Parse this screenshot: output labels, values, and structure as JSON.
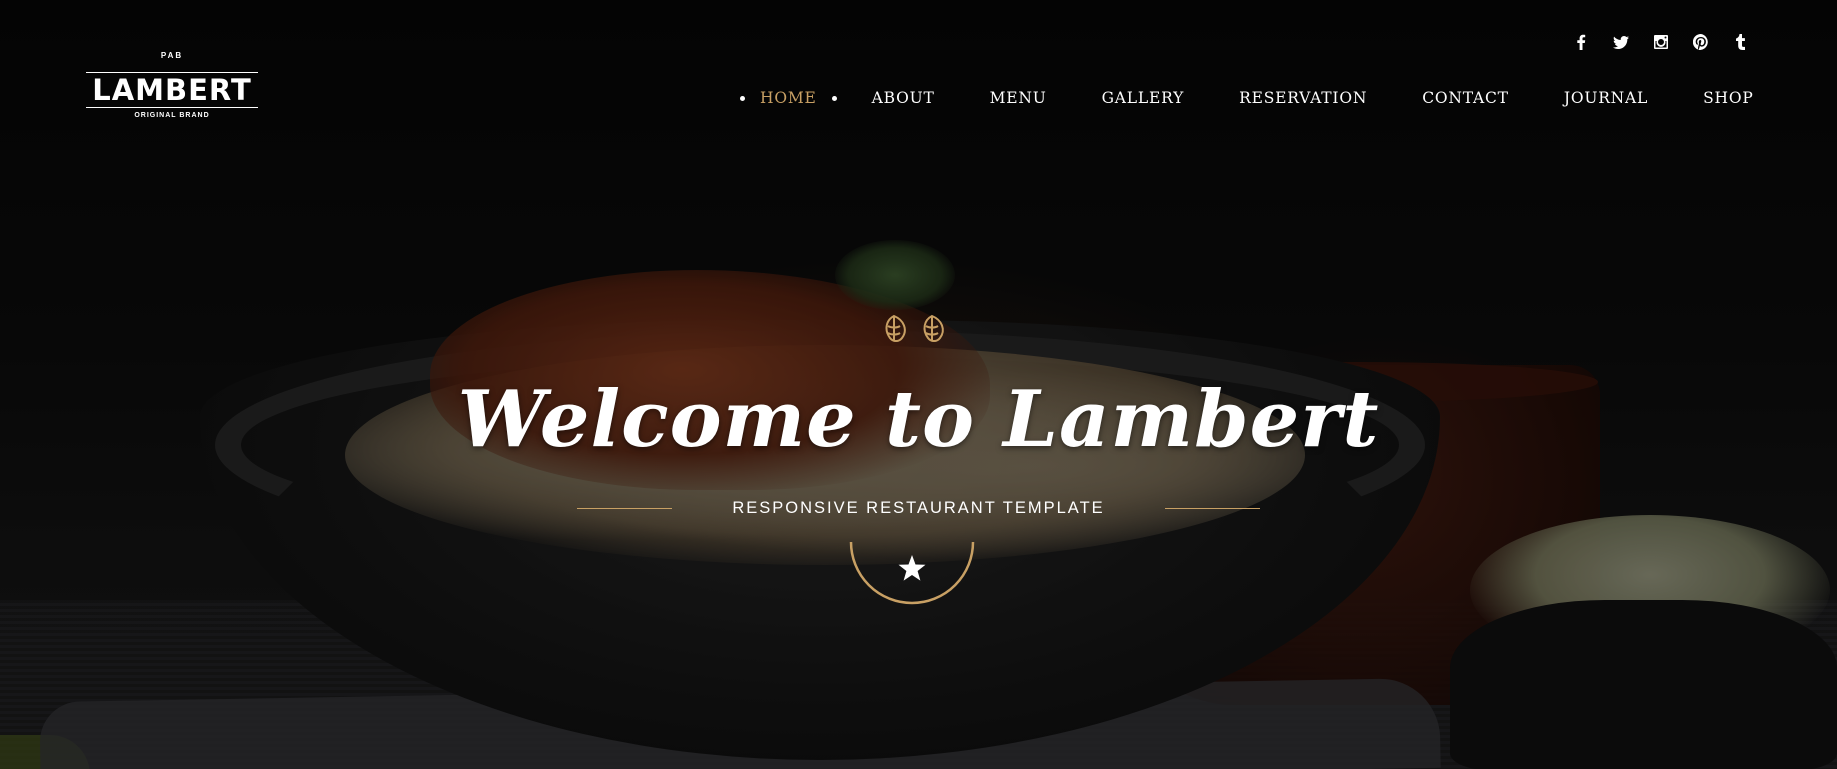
{
  "brand": {
    "top": "PAB",
    "name": "LAMBERT",
    "sub": "ORIGINAL BRAND"
  },
  "social": [
    {
      "icon": "facebook-icon"
    },
    {
      "icon": "twitter-icon"
    },
    {
      "icon": "instagram-icon"
    },
    {
      "icon": "pinterest-icon"
    },
    {
      "icon": "tumblr-icon"
    }
  ],
  "nav": {
    "items": [
      {
        "label": "HOME",
        "active": true
      },
      {
        "label": "ABOUT"
      },
      {
        "label": "MENU"
      },
      {
        "label": "GALLERY"
      },
      {
        "label": "RESERVATION"
      },
      {
        "label": "CONTACT"
      },
      {
        "label": "JOURNAL"
      },
      {
        "label": "SHOP"
      }
    ]
  },
  "hero": {
    "title": "Welcome to Lambert",
    "subtitle": "RESPONSIVE RESTAURANT TEMPLATE"
  },
  "colors": {
    "accent": "#c8a064",
    "text": "#ffffff",
    "background": "#0b0b0b"
  }
}
